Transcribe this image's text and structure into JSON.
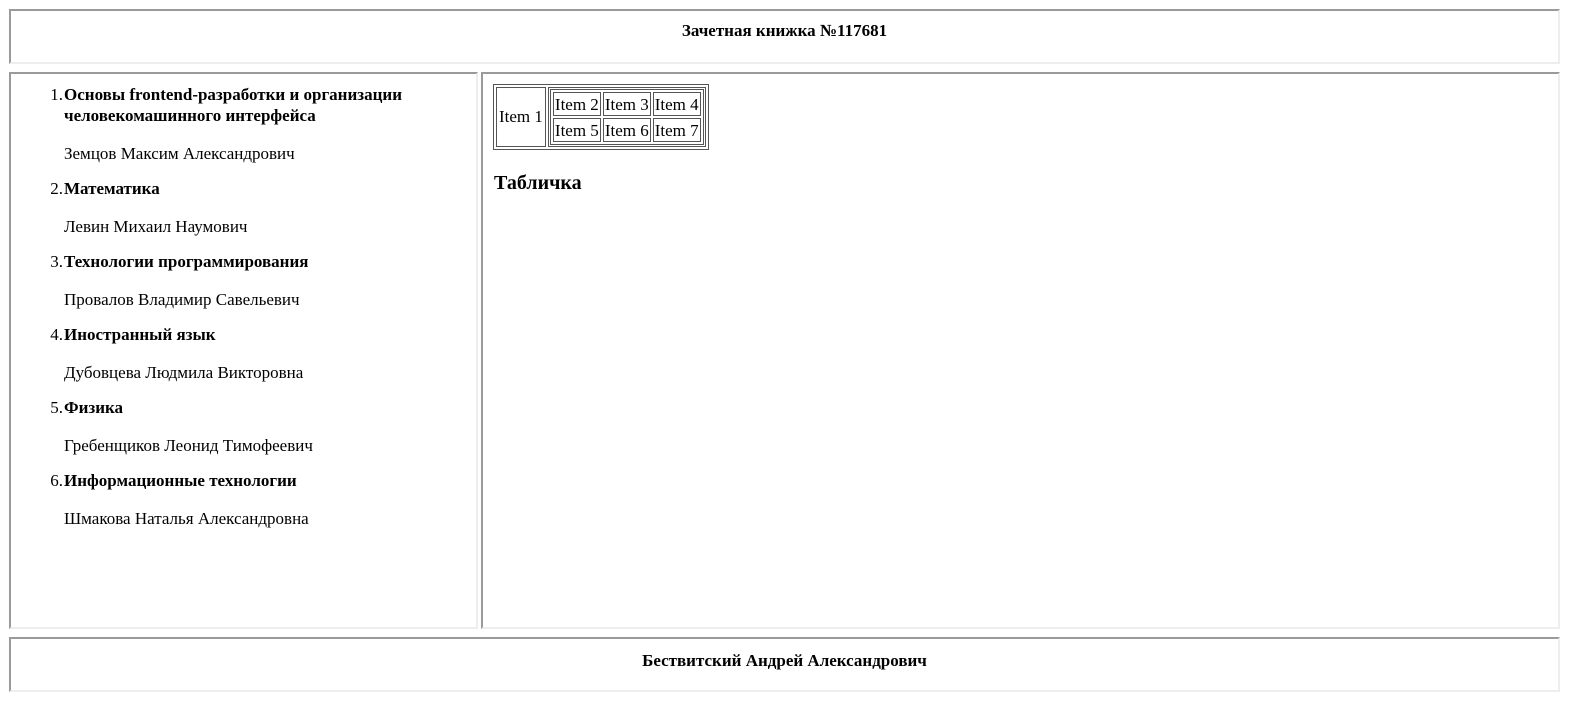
{
  "header": {
    "title": "Зачетная книжка №117681"
  },
  "sidebar": {
    "courses": [
      {
        "number": "1.",
        "name": "Основы frontend-разработки и организации человекомашинного интерфейса",
        "teacher": "Земцов Максим Александрович"
      },
      {
        "number": "2.",
        "name": "Математика",
        "teacher": "Левин Михаил Наумович"
      },
      {
        "number": "3.",
        "name": "Технологии программирования",
        "teacher": "Провалов Владимир Савельевич"
      },
      {
        "number": "4.",
        "name": "Иностранный язык",
        "teacher": "Дубовцева Людмила Викторовна"
      },
      {
        "number": "5.",
        "name": "Физика",
        "teacher": "Гребенщиков Леонид Тимофеевич"
      },
      {
        "number": "6.",
        "name": "Информационные технологии",
        "teacher": "Шмакова Наталья Александровна"
      }
    ]
  },
  "main": {
    "table": {
      "item1": "Item 1",
      "row1": [
        "Item 2",
        "Item 3",
        "Item 4"
      ],
      "row2": [
        "Item 5",
        "Item 6",
        "Item 7"
      ]
    },
    "heading": "Табличка"
  },
  "footer": {
    "author": "Бествитский Андрей Александрович"
  }
}
